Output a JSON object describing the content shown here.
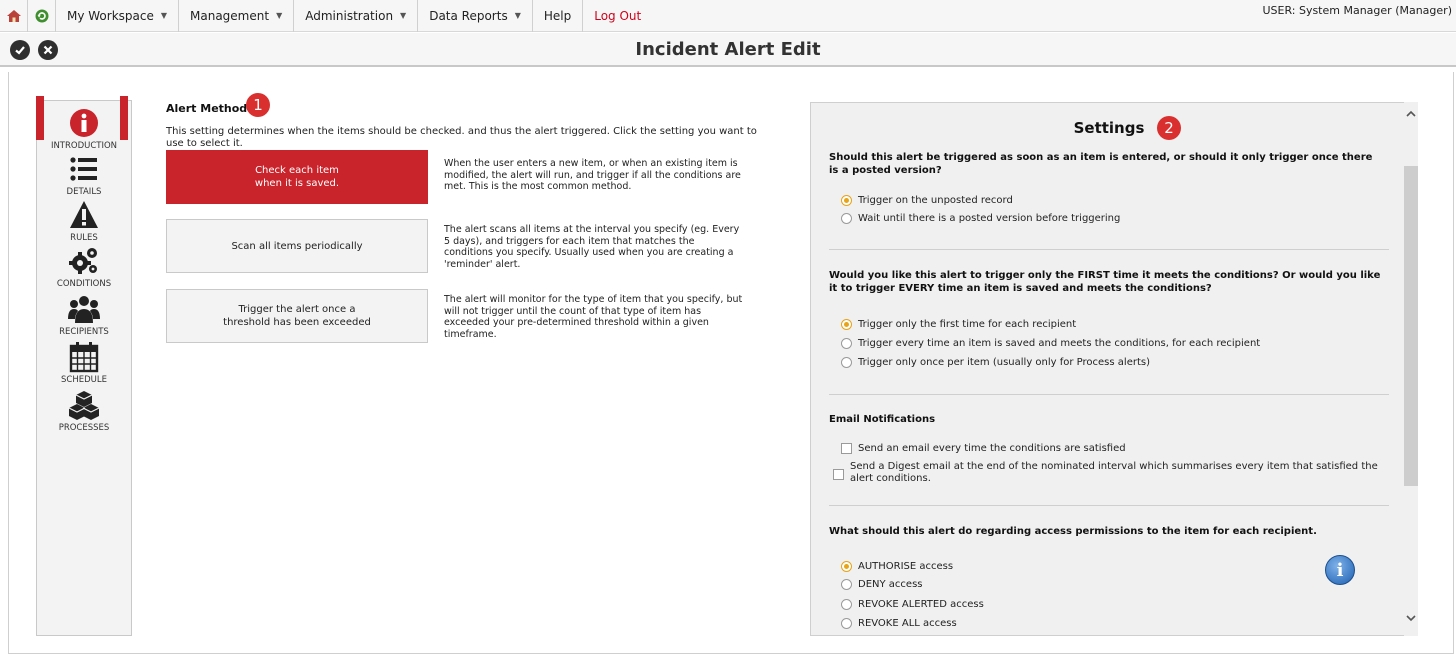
{
  "menu": {
    "items": [
      {
        "label": "My Workspace",
        "has_dropdown": true
      },
      {
        "label": "Management",
        "has_dropdown": true
      },
      {
        "label": "Administration",
        "has_dropdown": true
      },
      {
        "label": "Data Reports",
        "has_dropdown": true
      },
      {
        "label": "Help",
        "has_dropdown": false
      }
    ],
    "logout_label": "Log Out",
    "user_label": "USER: System Manager (Manager)"
  },
  "titlebar": {
    "title": "Incident Alert Edit",
    "save_icon": "check-circle-icon",
    "cancel_icon": "x-circle-icon"
  },
  "nav": {
    "items": [
      {
        "label": "INTRODUCTION",
        "icon": "info-circle-icon"
      },
      {
        "label": "DETAILS",
        "icon": "list-icon"
      },
      {
        "label": "RULES",
        "icon": "warning-triangle-icon"
      },
      {
        "label": "CONDITIONS",
        "icon": "gears-icon"
      },
      {
        "label": "RECIPIENTS",
        "icon": "users-icon"
      },
      {
        "label": "SCHEDULE",
        "icon": "calendar-icon"
      },
      {
        "label": "PROCESSES",
        "icon": "cubes-icon"
      }
    ],
    "active": "RULES"
  },
  "alert_method": {
    "title": "Alert Method",
    "badge": "1",
    "intro": "This setting determines when the items should be checked. and thus the alert triggered. Click the setting you want to use to select it.",
    "options": [
      {
        "label_line1": "Check each item",
        "label_line2": "when it is saved.",
        "active": true,
        "description": "When the user enters a new item, or when an existing item is modified, the alert will run, and trigger if all the conditions are met. This is the most common method."
      },
      {
        "label_line1": "Scan all items periodically",
        "label_line2": "",
        "active": false,
        "description": "The alert scans all items at the interval you specify (eg. Every 5 days), and triggers for each item that matches the conditions you specify. Usually used when you are creating a 'reminder' alert."
      },
      {
        "label_line1": "Trigger the alert once a",
        "label_line2": "threshold has been exceeded",
        "active": false,
        "description": "The alert will monitor for the type of item that you specify, but will not trigger until the count of that type of item has exceeded your pre-determined threshold within a given timeframe."
      }
    ]
  },
  "settings": {
    "title": "Settings",
    "badge": "2",
    "q1": {
      "question": "Should this alert be triggered as soon as an item is entered, or should it only trigger once there is a posted version?",
      "options": [
        "Trigger on the unposted record",
        "Wait until there is a posted version before triggering"
      ],
      "selected": 0
    },
    "q2": {
      "question": "Would you like this alert to trigger only the FIRST time it meets the conditions? Or would you like it to trigger EVERY time an item is saved and meets the conditions?",
      "options": [
        "Trigger only the first time for each recipient",
        "Trigger every time an item is saved and meets the conditions, for each recipient",
        "Trigger only once per item (usually only for Process alerts)"
      ],
      "selected": 0
    },
    "q3": {
      "question": "Email Notifications",
      "options": [
        "Send an email every time the conditions are satisfied",
        "Send a Digest email at the end of the nominated interval which summarises every item that satisfied the alert conditions."
      ]
    },
    "q4": {
      "question": "What should this alert do regarding access permissions to the item for each recipient.",
      "options": [
        "AUTHORISE access",
        "DENY access",
        "REVOKE ALERTED access",
        "REVOKE ALL access"
      ],
      "selected": 0
    }
  },
  "colors": {
    "accent": "#c9242b",
    "radio_selected": "#e8a317",
    "info_blue": "#1d5fb0"
  }
}
